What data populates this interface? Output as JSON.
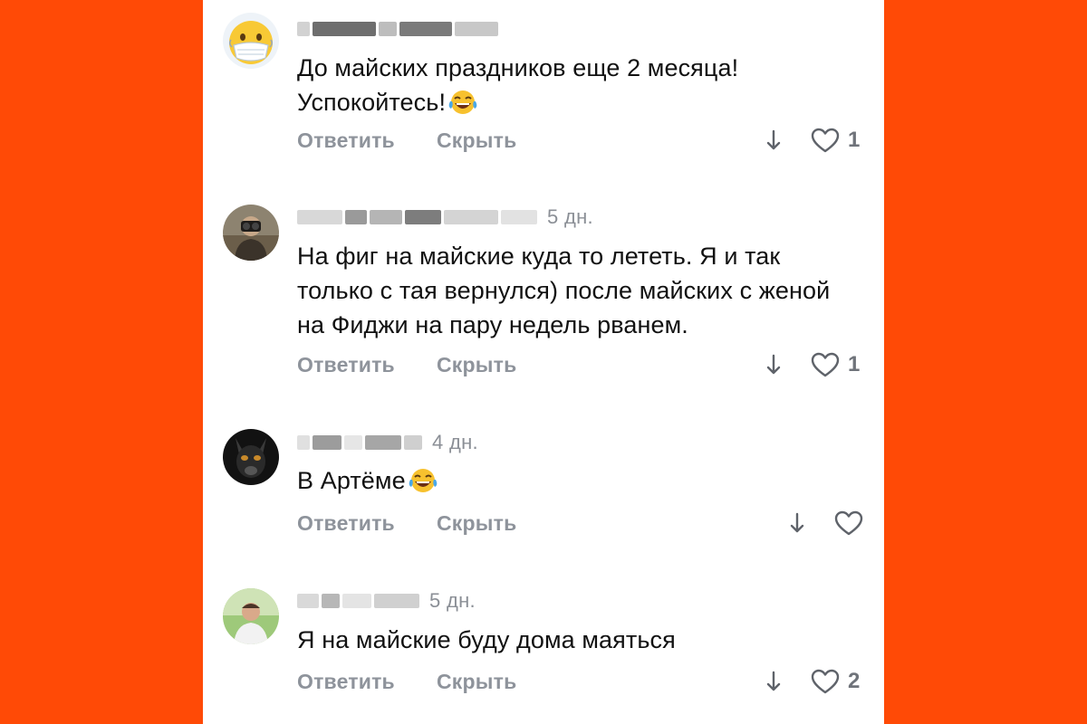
{
  "colors": {
    "background": "#ff4a06",
    "panel": "#ffffff",
    "text": "#111111",
    "muted": "#8e939b"
  },
  "comments": [
    {
      "time": "",
      "text": "До майских праздников еще 2 месяца! Успокойтесь!",
      "emoji": "tears-of-joy-emoji",
      "reply_label": "Ответить",
      "hide_label": "Скрыть",
      "likes": "1"
    },
    {
      "time": "5 дн.",
      "text": "На фиг на майские куда то лететь. Я и так только с тая вернулся) после майских с женой на Фиджи на пару недель рванем.",
      "reply_label": "Ответить",
      "hide_label": "Скрыть",
      "likes": "1"
    },
    {
      "time": "4 дн.",
      "text": "В Артёме",
      "emoji": "tears-of-joy-emoji",
      "reply_label": "Ответить",
      "hide_label": "Скрыть",
      "likes": ""
    },
    {
      "time": "5 дн.",
      "text": "Я на майские буду дома маяться",
      "reply_label": "Ответить",
      "hide_label": "Скрыть",
      "likes": "2"
    }
  ]
}
